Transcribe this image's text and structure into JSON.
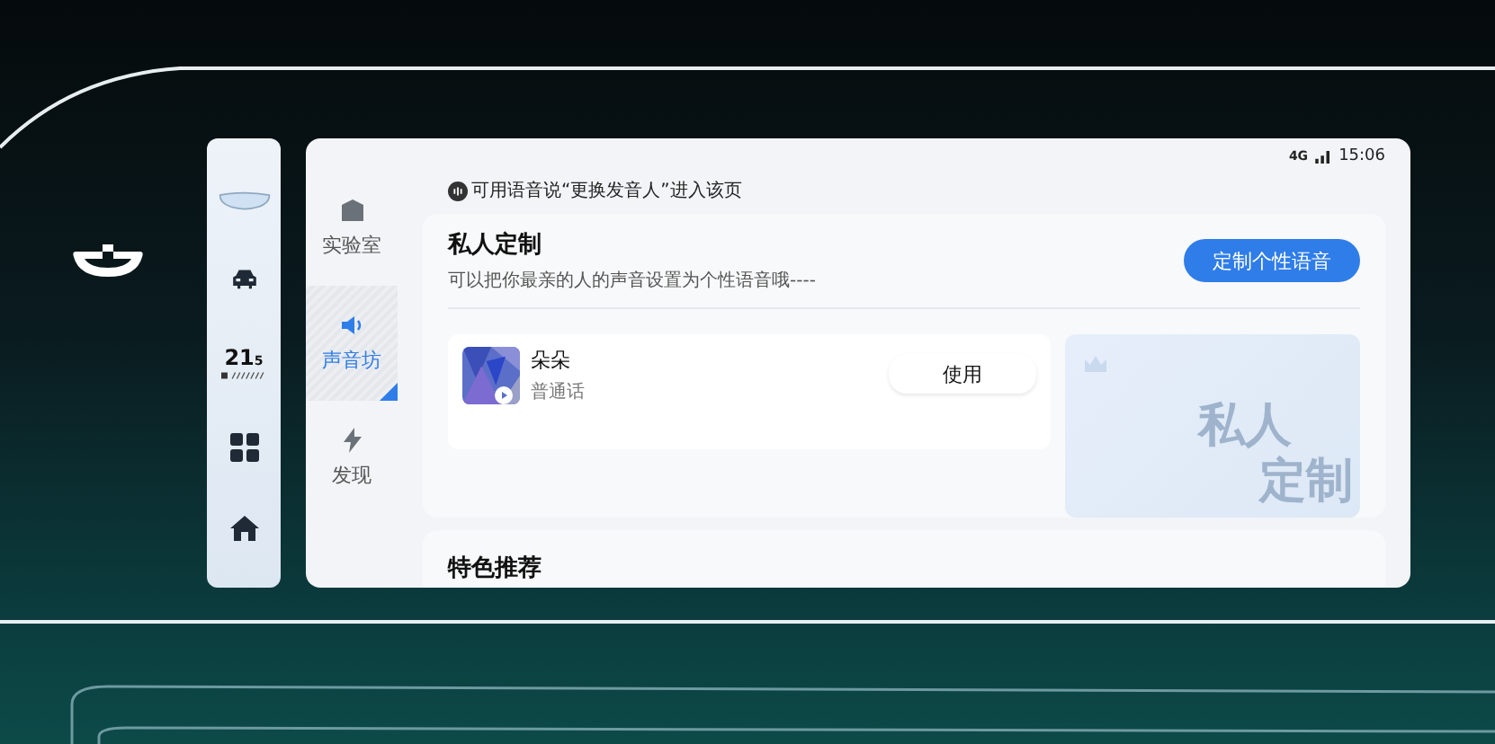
{
  "status_bar": {
    "network": "4G",
    "time": "15:06"
  },
  "dock": {
    "temperature": "21",
    "temperature_fraction": "5"
  },
  "nav": [
    {
      "label": "实验室",
      "kind": "lab",
      "selected": false
    },
    {
      "label": "声音坊",
      "kind": "sound",
      "selected": true
    },
    {
      "label": "发现",
      "kind": "discover",
      "selected": false
    }
  ],
  "voice_hint": "可用语音说“更换发音人”进入该页",
  "custom_section": {
    "title": "私人定制",
    "subtitle": "可以把你最亲的人的声音设置为个性语音哦----",
    "button": "定制个性语音",
    "voices": [
      {
        "name": "朵朵",
        "language": "普通话",
        "button": "使用"
      }
    ],
    "banner_text": [
      "私人",
      "定制"
    ]
  },
  "featured_section": {
    "title": "特色推荐"
  }
}
